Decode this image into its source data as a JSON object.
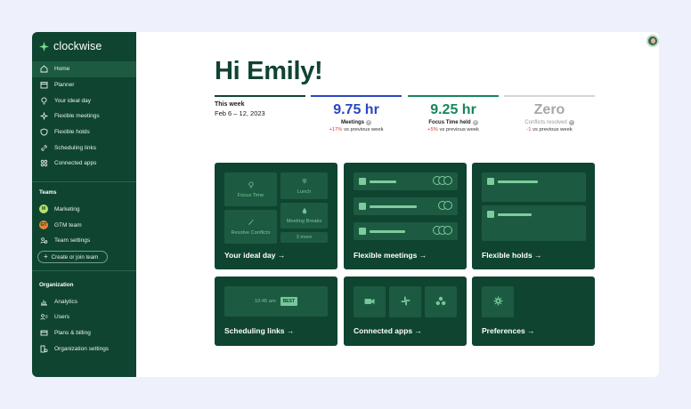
{
  "app": {
    "name": "clockwise"
  },
  "nav": [
    {
      "label": "Home",
      "icon": "home-icon",
      "active": true
    },
    {
      "label": "Planner",
      "icon": "calendar-icon"
    },
    {
      "label": "Your ideal day",
      "icon": "lightbulb-icon"
    },
    {
      "label": "Flexible meetings",
      "icon": "sparkle-icon"
    },
    {
      "label": "Flexible holds",
      "icon": "shield-icon"
    },
    {
      "label": "Scheduling links",
      "icon": "link-icon"
    },
    {
      "label": "Connected apps",
      "icon": "apps-icon"
    }
  ],
  "teams": {
    "title": "Teams",
    "items": [
      {
        "label": "Marketing",
        "badge": "M",
        "color": "#b6e36a"
      },
      {
        "label": "GTM team",
        "badge": "GT",
        "color": "#e8833a"
      },
      {
        "label": "Team settings",
        "icon": "team-settings-icon"
      }
    ],
    "create_label": "Create or join team"
  },
  "organization": {
    "title": "Organization",
    "items": [
      {
        "label": "Analytics",
        "icon": "analytics-icon"
      },
      {
        "label": "Users",
        "icon": "users-icon"
      },
      {
        "label": "Plans & billing",
        "icon": "billing-icon"
      },
      {
        "label": "Organization settings",
        "icon": "org-settings-icon"
      }
    ]
  },
  "greeting": "Hi Emily!",
  "stats": {
    "week": {
      "label": "This week",
      "range": "Feb 6 – 12, 2023"
    },
    "meetings": {
      "value": "9.75 hr",
      "label": "Meetings",
      "delta": "+17%",
      "delta_suffix": " vs previous week",
      "color": "#2a47c2"
    },
    "focus": {
      "value": "9.25 hr",
      "label": "Focus Time held",
      "delta": "+5%",
      "delta_suffix": " vs previous week",
      "color": "#15875a"
    },
    "conflicts": {
      "value": "Zero",
      "label": "Conflicts resolved",
      "delta": "-1",
      "delta_suffix": " vs previous week",
      "color": "#a7a7a7"
    }
  },
  "cards": {
    "ideal_day": {
      "title": "Your ideal day →",
      "tiles": {
        "focus": "Focus Time",
        "lunch": "Lunch",
        "resolve": "Resolve Conflicts",
        "breaks": "Meeting Breaks",
        "more": "3 more"
      }
    },
    "flex_meetings": {
      "title": "Flexible meetings →"
    },
    "flex_holds": {
      "title": "Flexible holds →"
    },
    "scheduling": {
      "title": "Scheduling links →",
      "time": "10:45 am",
      "tag": "BEST"
    },
    "connected": {
      "title": "Connected apps →"
    },
    "preferences": {
      "title": "Preferences →"
    }
  }
}
